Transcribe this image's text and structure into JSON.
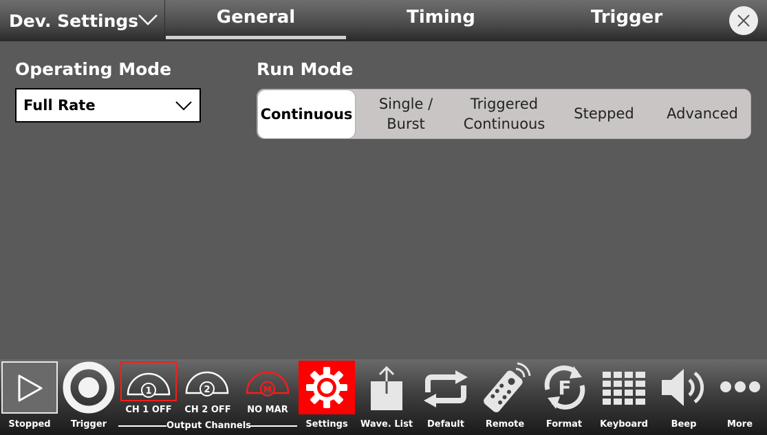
{
  "header": {
    "dev_settings_label": "Dev. Settings",
    "tabs": [
      {
        "label": "General",
        "active": true
      },
      {
        "label": "Timing",
        "active": false
      },
      {
        "label": "Trigger",
        "active": false
      }
    ]
  },
  "general": {
    "operating_mode_title": "Operating Mode",
    "operating_mode_value": "Full Rate",
    "run_mode_title": "Run Mode",
    "run_modes": [
      {
        "label_line1": "Continuous",
        "label_line2": "",
        "active": true
      },
      {
        "label_line1": "Single /",
        "label_line2": "Burst",
        "active": false
      },
      {
        "label_line1": "Triggered",
        "label_line2": "Continuous",
        "active": false
      },
      {
        "label_line1": "Stepped",
        "label_line2": "",
        "active": false
      },
      {
        "label_line1": "Advanced",
        "label_line2": "",
        "active": false
      }
    ]
  },
  "toolbar": {
    "stopped": "Stopped",
    "trigger": "Trigger",
    "ch1": "CH 1 OFF",
    "ch1_number": "1",
    "ch2": "CH 2 OFF",
    "ch2_number": "2",
    "marker": "NO MAR",
    "marker_letter": "M",
    "output_channels": "Output Channels",
    "settings": "Settings",
    "wave_list": "Wave. List",
    "default": "Default",
    "remote": "Remote",
    "format": "Format",
    "format_letter": "F",
    "keyboard": "Keyboard",
    "beep": "Beep",
    "more": "More"
  },
  "colors": {
    "accent_red": "#ff0000",
    "background": "#5a5a5a",
    "segment_bg": "#c9c5c4"
  },
  "icons": {
    "close": "close-icon",
    "play": "play-icon",
    "trigger": "trigger-icon",
    "settings": "gear-icon",
    "wave_list": "upload-icon",
    "default": "repeat-icon",
    "remote": "remote-control-icon",
    "format": "format-icon",
    "keyboard": "keypad-icon",
    "beep": "speaker-icon",
    "more": "more-icon"
  }
}
